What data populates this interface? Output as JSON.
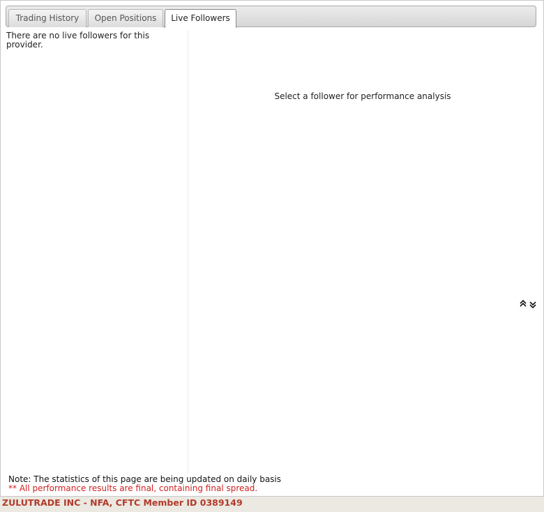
{
  "tabs": [
    {
      "label": "Trading History",
      "active": false
    },
    {
      "label": "Open Positions",
      "active": false
    },
    {
      "label": "Live Followers",
      "active": true
    }
  ],
  "left_pane": {
    "message": "There are no live followers for this provider."
  },
  "right_pane": {
    "message": "Select a follower for performance analysis"
  },
  "icons": {
    "scroll_toggle": "expand-collapse-chevrons-icon"
  },
  "notes": {
    "update_note": "Note: The statistics of this page are being updated on daily basis",
    "disclaimer": "** All performance results are final, containing final spread."
  },
  "footer": {
    "text": "ZULUTRADE INC - NFA, CFTC Member ID 0389149"
  },
  "colors": {
    "disclaimer": "#d21f1f",
    "footer_text": "#b23a2a",
    "footer_bg": "#ebe9e1"
  }
}
